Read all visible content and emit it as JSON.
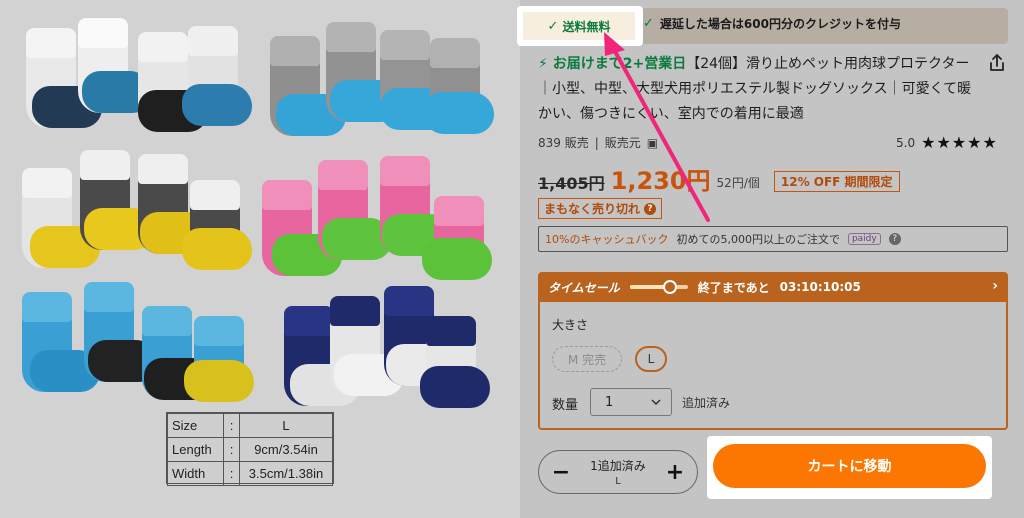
{
  "shipping": {
    "free_shipping": "送料無料",
    "delay_credit": "遅延した場合は600円分のクレジットを付与"
  },
  "product": {
    "delivery": "お届けまで2+営業日",
    "title": "【24個】滑り止めペット用肉球プロテクター｜小型、中型、大型犬用ポリエステル製ドッグソックス｜可愛くて暖かい、傷つきにくい、室内での着用に最適",
    "sold": "839 販売",
    "seller": "販売元",
    "rating": "5.0",
    "stars": "★★★★★"
  },
  "price": {
    "original": "1,405円",
    "current": "1,230円",
    "unit": "52円/個",
    "discount": "12% OFF 期間限定",
    "selling_fast": "まもなく売り切れ"
  },
  "cashback": {
    "percent": "10%のキャッシュバック",
    "condition": "初めての5,000円以上のご注文で",
    "provider": "paidy"
  },
  "timesale": {
    "title": "タイムセール",
    "ends_in": "終了まであと",
    "countdown": "03:10:10:05",
    "progress": 0.7
  },
  "options": {
    "size_label": "大きさ",
    "sizes": [
      {
        "label": "M 完売",
        "available": false
      },
      {
        "label": "L",
        "available": true,
        "selected": true
      }
    ],
    "qty_label": "数量",
    "qty_value": "1",
    "added_note": "追加済み"
  },
  "cart": {
    "added_count": "1追加済み",
    "selected_size": "L",
    "minus": "−",
    "plus": "+",
    "go_to_cart": "カートに移動"
  },
  "size_chart": {
    "rows": [
      {
        "key": "Size",
        "value": "L"
      },
      {
        "key": "Length",
        "value": "9cm/3.54in"
      },
      {
        "key": "Width",
        "value": "3.5cm/1.38in"
      }
    ],
    "colon": ":"
  },
  "colors": {
    "accent_orange": "#fb7701",
    "price_orange": "#c8530c",
    "green": "#0b7a3e",
    "arrow_pink": "#f0267a"
  },
  "icons": [
    "check-icon",
    "bolt-icon",
    "share-icon",
    "chevron-down-icon",
    "chevron-right-icon",
    "help-icon",
    "arrow-annotation"
  ]
}
